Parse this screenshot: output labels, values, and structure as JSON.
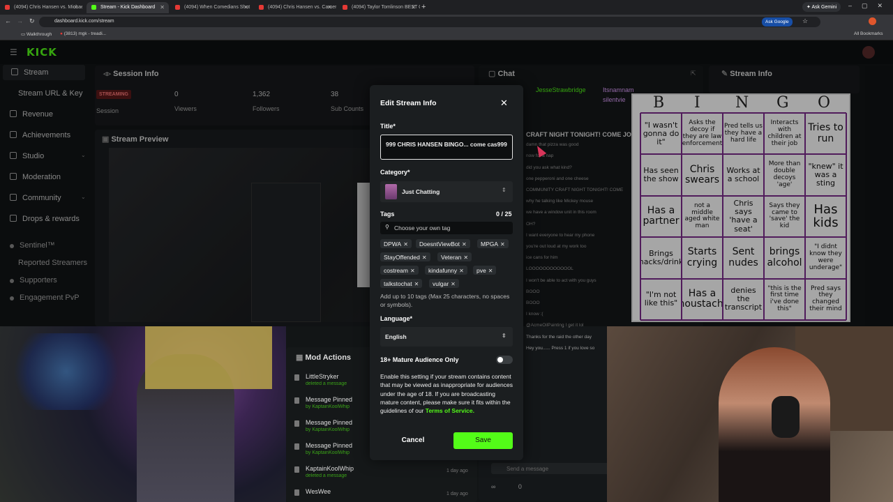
{
  "browser": {
    "tabs": [
      {
        "label": "(4094) Chris Hansen vs. Michae",
        "active": false
      },
      {
        "label": "Stream - Kick Dashboard",
        "active": true
      },
      {
        "label": "(4094) When Comedians Shut",
        "active": false
      },
      {
        "label": "(4094) Chris Hansen vs. Camer",
        "active": false
      },
      {
        "label": "(4094) Taylor Tomlinson BEST C",
        "active": false
      }
    ],
    "ask_gemini": "Ask Gemini",
    "url": "dashboard.kick.com/stream",
    "ask_google": "Ask Google",
    "bookmarks": [
      "Walkthrough",
      "(3813) mgk - treadi..."
    ],
    "all_bookmarks": "All Bookmarks"
  },
  "app": {
    "logo": "KICK",
    "sidebar": [
      {
        "label": "Stream"
      },
      {
        "label": "Stream URL & Key"
      },
      {
        "label": "Revenue"
      },
      {
        "label": "Achievements"
      },
      {
        "label": "Studio"
      },
      {
        "label": "Moderation"
      },
      {
        "label": "Community"
      },
      {
        "label": "Drops & rewards"
      },
      {
        "label": "Sentinel™"
      },
      {
        "label": "Reported Streamers"
      },
      {
        "label": "Supporters"
      },
      {
        "label": "Engagement PvP"
      }
    ],
    "session": {
      "title": "Session Info",
      "badge": "STREAMING",
      "stats": [
        {
          "value": "0",
          "label": "Viewers"
        },
        {
          "value": "1,362",
          "label": "Followers"
        },
        {
          "value": "38",
          "label": "Sub Counts"
        }
      ],
      "session_label": "Session"
    },
    "preview_title": "Stream Preview",
    "mod_actions": {
      "title": "Mod Actions",
      "items": [
        {
          "title": "LittleStryker",
          "sub": "deleted a message",
          "time": ""
        },
        {
          "title": "Message Pinned",
          "sub": "by KaptainKoolWhip",
          "time": ""
        },
        {
          "title": "Message Pinned",
          "sub": "by KaptainKoolWhip",
          "time": ""
        },
        {
          "title": "Message Pinned",
          "sub": "by KaptainKoolWhip",
          "time": ""
        },
        {
          "title": "KaptainKoolWhip",
          "sub": "deleted a message",
          "time": "1 day ago"
        },
        {
          "title": "WesWee",
          "sub": "",
          "time": "1 day ago"
        }
      ]
    },
    "chat": {
      "title": "Chat",
      "users": [
        "JesseStrawbridge",
        "Itsnamnam",
        "silentvie"
      ],
      "lines": [
        "CRAFT NIGHT TONIGHT! COME JOI",
        "damn that pizza was good",
        "now for a nap",
        "did you ask what kind?",
        "one pepperoni and one cheese",
        "COMMUNITY CRAFT NIGHT TONIGHT! COME",
        "why he talking like Mickey mouse",
        "we have a window unit in this room",
        "OH?",
        "I want everyone to hear my phone",
        "you're out loud at my work too",
        "ice cans for him",
        "LOOOOOOOOOOOOL",
        "I won't be able to act with you guys",
        "BOOO",
        "BOOO",
        "I know :(",
        "@AcmeOilPainting I get it lol",
        "Thanks for the raid the other day",
        "Hey you...... Press 1 if you love so"
      ],
      "send_placeholder": "Send a message",
      "viewer_count": "0"
    },
    "stream_info": {
      "title": "Stream Info"
    }
  },
  "modal": {
    "title": "Edit Stream Info",
    "title_label": "Title*",
    "title_value": "999 CHRIS HANSEN BINGO... come cas999",
    "category_label": "Category*",
    "category_value": "Just Chatting",
    "tags_label": "Tags",
    "tags_count": "0 / 25",
    "tags_placeholder": "Choose your own tag",
    "tags": [
      "DPWA",
      "DoesntViewBot",
      "MPGA",
      "StayOffended",
      "Veteran",
      "costream",
      "kindafunny",
      "pve",
      "talkstochat",
      "vulgar"
    ],
    "tags_help": "Add up to 10 tags (Max 25 characters, no spaces or symbols).",
    "language_label": "Language*",
    "language_value": "English",
    "mature_label": "18+ Mature Audience Only",
    "mature_help": "Enable this setting if your stream contains content that may be viewed as inappropriate for audiences under the age of 18. If you are broadcasting mature content, please make sure it fits within the guidelines of our",
    "terms_link": "Terms of Service.",
    "cancel": "Cancel",
    "save": "Save"
  },
  "bingo": {
    "header": [
      "B",
      "I",
      "N",
      "G",
      "O"
    ],
    "cells": [
      [
        "\"I wasn't gonna do it\"",
        "Asks the decoy if they are law enforcement",
        "Pred tells us they have a hard life",
        "Interacts with children at their job",
        "Tries to run"
      ],
      [
        "Has seen the show",
        "Chris swears",
        "Works at a school",
        "More than double decoys 'age'",
        "\"knew\" it was a sting"
      ],
      [
        "Has a partner",
        "not a middle aged white man",
        "Chris says 'have a seat'",
        "Says they came to 'save' the kid",
        "Has kids"
      ],
      [
        "Brings snacks/drinks",
        "Starts crying",
        "Sent nudes",
        "brings alcohol",
        "\"I didnt know they were underage\""
      ],
      [
        "\"I'm not like this\"",
        "Has a moustache",
        "denies the transcript",
        "\"this is the first time i've done this\"",
        "Pred says they changed their mind"
      ]
    ]
  },
  "colors": {
    "kick_green": "#53fc18",
    "bingo_grid": "#7b2a8c",
    "streaming_badge": "#e53935"
  }
}
